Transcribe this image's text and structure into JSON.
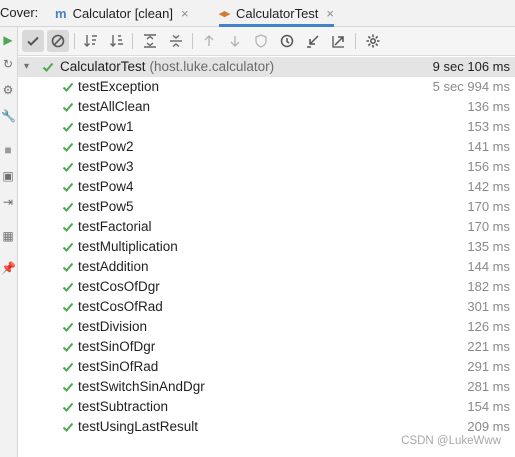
{
  "tabs": {
    "prefix": "Cover:",
    "items": [
      {
        "label": "Calculator [clean]",
        "icon": "module-icon",
        "active": false
      },
      {
        "label": "CalculatorTest",
        "icon": "test-class-icon",
        "active": true
      }
    ],
    "close_glyph": "×"
  },
  "toolbar": {
    "buttons": [
      "show-passed",
      "show-ignored",
      "sort-alphabetically",
      "sort-by-duration",
      "expand-all",
      "collapse-all",
      "previous-failed",
      "next-failed",
      "coverage",
      "history",
      "import-tests",
      "export-tests",
      "settings"
    ]
  },
  "tree": {
    "root": {
      "name": "CalculatorTest",
      "package": "(host.luke.calculator)",
      "duration": "9 sec 106 ms",
      "status": "passed"
    },
    "tests": [
      {
        "name": "testException",
        "duration": "5 sec 994 ms"
      },
      {
        "name": "testAllClean",
        "duration": "136 ms"
      },
      {
        "name": "testPow1",
        "duration": "153 ms"
      },
      {
        "name": "testPow2",
        "duration": "141 ms"
      },
      {
        "name": "testPow3",
        "duration": "156 ms"
      },
      {
        "name": "testPow4",
        "duration": "142 ms"
      },
      {
        "name": "testPow5",
        "duration": "170 ms"
      },
      {
        "name": "testFactorial",
        "duration": "170 ms"
      },
      {
        "name": "testMultiplication",
        "duration": "135 ms"
      },
      {
        "name": "testAddition",
        "duration": "144 ms"
      },
      {
        "name": "testCosOfDgr",
        "duration": "182 ms"
      },
      {
        "name": "testCosOfRad",
        "duration": "301 ms"
      },
      {
        "name": "testDivision",
        "duration": "126 ms"
      },
      {
        "name": "testSinOfDgr",
        "duration": "221 ms"
      },
      {
        "name": "testSinOfRad",
        "duration": "291 ms"
      },
      {
        "name": "testSwitchSinAndDgr",
        "duration": "281 ms"
      },
      {
        "name": "testSubtraction",
        "duration": "154 ms"
      },
      {
        "name": "testUsingLastResult",
        "duration": "209 ms"
      }
    ]
  },
  "watermark": "CSDN @LukeWww",
  "colors": {
    "pass": "#4fa84f",
    "accent": "#4083c9",
    "root_row": "#e4e4e4"
  }
}
